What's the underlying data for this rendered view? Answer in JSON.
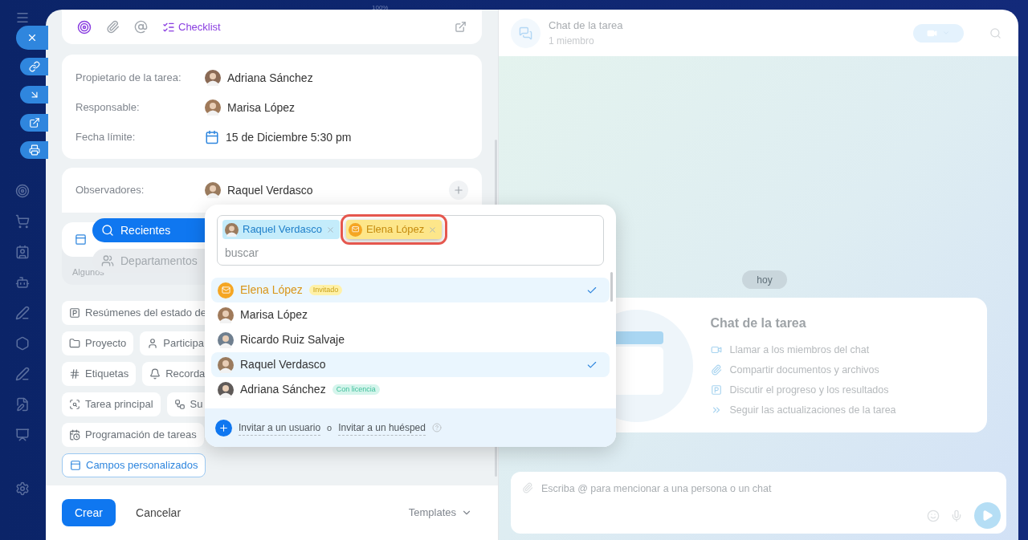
{
  "zoom_label": "100%",
  "toolbar": {
    "checklist": "Checklist"
  },
  "fields": [
    {
      "label": "Propietario de la tarea:",
      "value": "Adriana Sánchez",
      "kind": "person"
    },
    {
      "label": "Responsable:",
      "value": "Marisa López",
      "kind": "person"
    },
    {
      "label": "Fecha límite:",
      "value": "15 de Diciembre 5:30 pm",
      "kind": "date"
    }
  ],
  "observers": {
    "label": "Observadores:",
    "value": "Raquel Verdasco"
  },
  "custom_fields_hint": "Algunos",
  "view_tabs": [
    {
      "label": "Recientes",
      "kind": "search",
      "selected": true
    },
    {
      "label": "Departamentos",
      "kind": "people",
      "selected": false
    }
  ],
  "chip_rows": [
    [
      {
        "label": "Resúmenes del estado de",
        "kind": "report",
        "active": false
      }
    ],
    [
      {
        "label": "Proyecto",
        "kind": "folder",
        "active": false
      },
      {
        "label": "Participa",
        "kind": "person",
        "active": false
      }
    ],
    [
      {
        "label": "Etiquetas",
        "kind": "hash",
        "active": false
      },
      {
        "label": "Recorda",
        "kind": "bell",
        "active": false
      }
    ],
    [
      {
        "label": "Tarea principal",
        "kind": "parent",
        "active": false
      },
      {
        "label": "Su",
        "kind": "subtask",
        "active": false
      }
    ],
    [
      {
        "label": "Programación de tareas",
        "kind": "schedule",
        "active": false
      }
    ],
    [
      {
        "label": "Campos personalizados",
        "kind": "fields",
        "active": true
      }
    ]
  ],
  "footer": {
    "create": "Crear",
    "cancel": "Cancelar",
    "templates": "Templates"
  },
  "selector": {
    "tags": [
      {
        "name": "Raquel Verdasco",
        "kind": "employee",
        "highlighted": false
      },
      {
        "name": "Elena López",
        "kind": "guest",
        "highlighted": true
      }
    ],
    "placeholder": "buscar",
    "people": [
      {
        "name": "Elena López",
        "kind": "guest",
        "badge": "Invitado",
        "selected": true
      },
      {
        "name": "Marisa López",
        "kind": "employee",
        "selected": false
      },
      {
        "name": "Ricardo Ruiz Salvaje",
        "kind": "employee",
        "selected": false
      },
      {
        "name": "Raquel Verdasco",
        "kind": "employee",
        "selected": true
      },
      {
        "name": "Adriana Sánchez",
        "kind": "licensed",
        "badge": "Con licencia",
        "selected": false
      }
    ],
    "invite_user": "Invitar a un usuario",
    "separator": "o",
    "invite_guest": "Invitar a un huésped"
  },
  "chat": {
    "title": "Chat de la tarea",
    "subtitle": "1 miembro",
    "date": "hoy",
    "card_title": "Chat de la tarea",
    "features": [
      {
        "text": "Llamar a los miembros del chat",
        "kind": "video"
      },
      {
        "text": "Compartir documentos y archivos",
        "kind": "attach"
      },
      {
        "text": "Discutir el progreso y los resultados",
        "kind": "discuss"
      },
      {
        "text": "Seguir las actualizaciones de la tarea",
        "kind": "follow"
      }
    ],
    "input_placeholder": "Escriba @ para mencionar a una persona o un chat"
  }
}
